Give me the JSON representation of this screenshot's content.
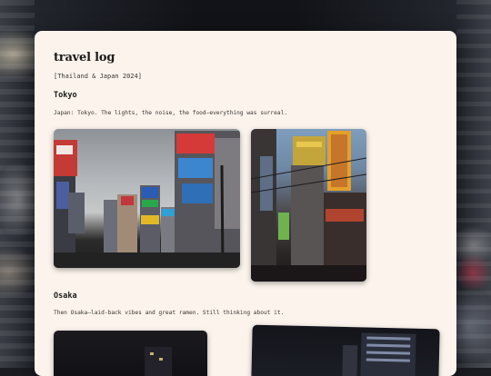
{
  "log": {
    "title": "travel log",
    "subtitle": "[Thailand & Japan 2024]"
  },
  "sections": [
    {
      "heading": "Tokyo",
      "text": "Japan: Tokyo. The lights, the noise, the food—everything was surreal."
    },
    {
      "heading": "Osaka",
      "text": "Then Osaka—laid-back vibes and great ramen. Still thinking about it."
    }
  ],
  "colors": {
    "card": "#fbf3ec",
    "text": "#1d1a18"
  }
}
